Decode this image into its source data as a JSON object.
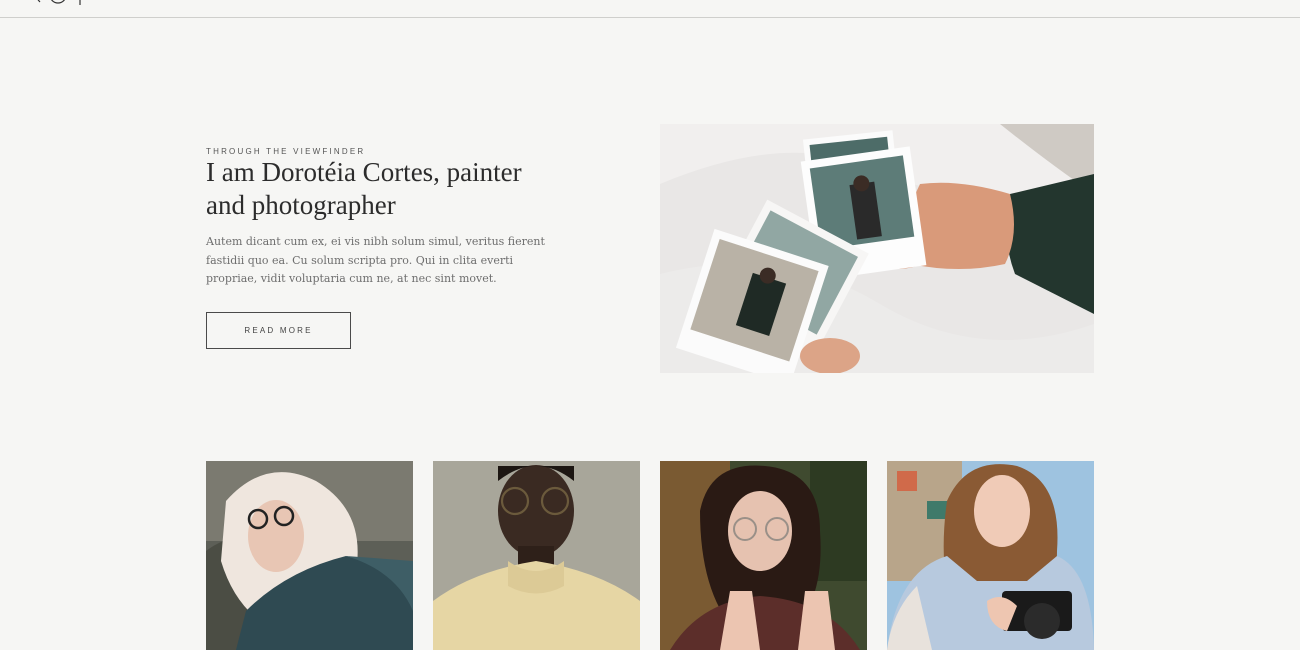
{
  "header": {
    "logo_icon": "monogram-logo-icon"
  },
  "hero": {
    "eyebrow": "THROUGH THE VIEWFINDER",
    "title": "I am Dorotéia Cortes, painter and photographer",
    "body": "Autem dicant cum ex, ei vis nibh solum simul, veritus fierent fastidii quo ea. Cu solum scripta pro. Qui in clita everti propriae, vidit voluptaria cum ne, at nec sint movet.",
    "button_label": "READ MORE",
    "image": "polaroid-photos-in-hand"
  },
  "gallery": {
    "items": [
      {
        "image": "portrait-blonde-woman-glasses"
      },
      {
        "image": "portrait-man-round-glasses"
      },
      {
        "image": "portrait-woman-glasses-hands"
      },
      {
        "image": "portrait-woman-with-camera"
      }
    ]
  },
  "colors": {
    "background": "#f6f6f4",
    "text_dark": "#2c2c2c",
    "text_muted": "#6e6e6e",
    "border": "#4a4a4a"
  }
}
